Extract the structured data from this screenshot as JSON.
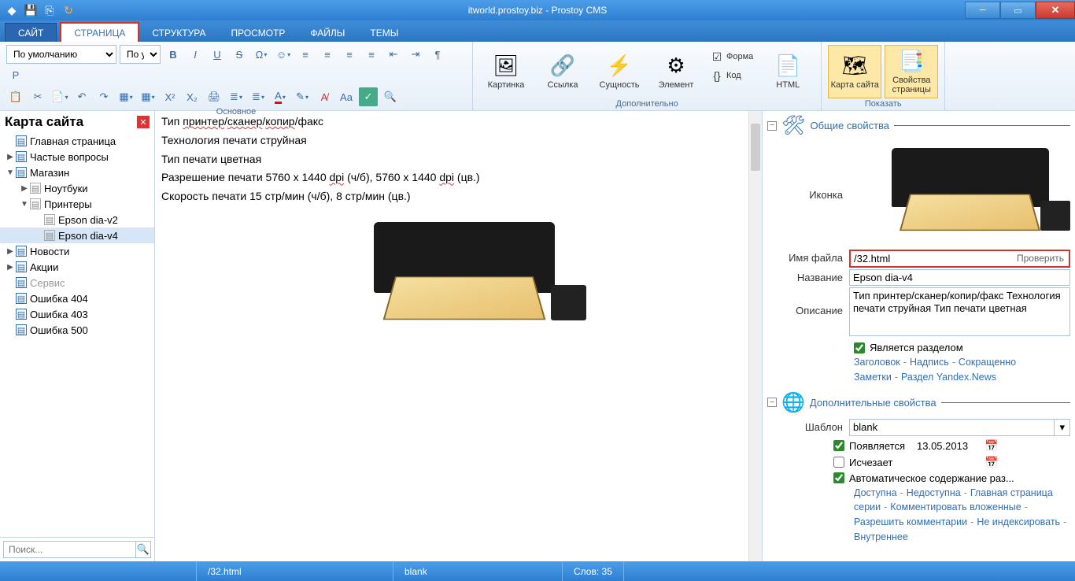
{
  "titlebar": {
    "title": "itworld.prostoy.biz - Prostoy CMS"
  },
  "menu": {
    "file": "САЙТ",
    "tabs": [
      "СТРАНИЦА",
      "СТРУКТУРА",
      "ПРОСМОТР",
      "ФАЙЛЫ",
      "ТЕМЫ"
    ],
    "active_index": 0
  },
  "ribbon": {
    "fontstyle_default": "По умолчанию",
    "fontstyle_second": "По ум",
    "group_main": "Основное",
    "group_extra": "Дополнительно",
    "group_show": "Показать",
    "big_picture": "Картинка",
    "big_link": "Ссылка",
    "big_entity": "Сущность",
    "big_element": "Элемент",
    "small_form": "Форма",
    "small_code": "Код",
    "big_html": "HTML",
    "big_sitemap": "Карта сайта",
    "big_pageprops": "Свойства страницы"
  },
  "sidebar": {
    "title": "Карта сайта",
    "search_placeholder": "Поиск...",
    "tree": [
      {
        "label": "Главная страница",
        "icon": "page",
        "indent": 0,
        "arrow": ""
      },
      {
        "label": "Частые вопросы",
        "icon": "page",
        "indent": 0,
        "arrow": "▶"
      },
      {
        "label": "Магазин",
        "icon": "page",
        "indent": 0,
        "arrow": "▼"
      },
      {
        "label": "Ноутбуки",
        "icon": "folder",
        "indent": 1,
        "arrow": "▶"
      },
      {
        "label": "Принтеры",
        "icon": "folder",
        "indent": 1,
        "arrow": "▼"
      },
      {
        "label": "Epson dia-v2",
        "icon": "folder",
        "indent": 2,
        "arrow": ""
      },
      {
        "label": "Epson dia-v4",
        "icon": "folder",
        "indent": 2,
        "arrow": "",
        "selected": true
      },
      {
        "label": "Новости",
        "icon": "page",
        "indent": 0,
        "arrow": "▶"
      },
      {
        "label": "Акции",
        "icon": "page",
        "indent": 0,
        "arrow": "▶"
      },
      {
        "label": "Сервис",
        "icon": "page",
        "indent": 0,
        "arrow": "",
        "disabled": true
      },
      {
        "label": "Ошибка 404",
        "icon": "page",
        "indent": 0,
        "arrow": ""
      },
      {
        "label": "Ошибка 403",
        "icon": "page",
        "indent": 0,
        "arrow": ""
      },
      {
        "label": "Ошибка 500",
        "icon": "page",
        "indent": 0,
        "arrow": ""
      }
    ]
  },
  "content": {
    "lines": {
      "l1a": "Тип ",
      "l1b": "принтер",
      "l1c": "/",
      "l1d": "сканер",
      "l1e": "/",
      "l1f": "копир",
      "l1g": "/факс",
      "l2": "Технология печати струйная",
      "l3": "Тип печати цветная",
      "l4a": "Разрешение печати 5760 x 1440 ",
      "l4b": "dpi",
      "l4c": " (ч/б), 5760 x 1440 ",
      "l4d": "dpi",
      "l4e": " (цв.)",
      "l5": "Скорость печати 15 стр/мин (ч/б), 8 стр/мин (цв.)"
    }
  },
  "props": {
    "sect_general": "Общие свойства",
    "sect_extra": "Дополнительные свойства",
    "label_icon": "Иконка",
    "label_filename": "Имя файла",
    "filename": "/32.html",
    "filename_check": "Проверить",
    "label_title": "Название",
    "title_val": "Epson dia-v4",
    "label_desc": "Описание",
    "desc_val": "Тип принтер/сканер/копир/факс Технология печати струйная Тип печати цветная",
    "cb_section": "Является разделом",
    "links1": [
      "Заголовок",
      "Надпись",
      "Сокращенно"
    ],
    "links2": [
      "Заметки",
      "Раздел Yandex.News"
    ],
    "label_template": "Шаблон",
    "template_val": "blank",
    "cb_appears": "Появляется",
    "date_appears": "13.05.2013",
    "cb_disappears": "Исчезает",
    "cb_autocontent": "Автоматическое содержание раз...",
    "links3": [
      "Доступна",
      "Недоступна",
      "Главная страница серии",
      "Комментировать вложенные",
      "Разрешить комментарии",
      "Не индексировать",
      "Внутреннее"
    ]
  },
  "status": {
    "filename": "/32.html",
    "template": "blank",
    "words": "Слов: 35"
  }
}
